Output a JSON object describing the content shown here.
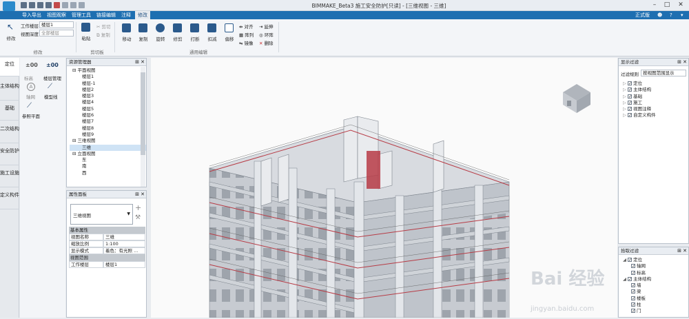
{
  "titlebar": {
    "title": "BIMMAKE_Beta3 施工安全防护[只读] - [三维视图 - 三维]",
    "window_buttons": [
      "–",
      "□",
      "✕"
    ]
  },
  "menubar": {
    "items": [
      "导入导出",
      "视图观察",
      "管理工具",
      "链接编辑",
      "注释",
      "修改"
    ],
    "active": "修改",
    "right_label": "正式版"
  },
  "ribbon": {
    "modify": {
      "label": "修改",
      "group": "修改"
    },
    "work_level_label": "工作楼层",
    "work_level_value": "楼层1",
    "view_depth_label": "视图深度",
    "view_depth_value": "全部楼层",
    "clipboard": {
      "paste": "粘贴",
      "cut": "剪切",
      "copy": "复制",
      "group": "剪切板"
    },
    "edit_tools": [
      "移动",
      "复制",
      "旋转",
      "修剪",
      "打断",
      "扣减",
      "偏移"
    ],
    "edit_small": [
      "对齐",
      "延伸",
      "阵列",
      "环阵",
      "镜像",
      "删除"
    ],
    "edit_group": "通用编辑"
  },
  "left_tabs": [
    "定位",
    "主体结构",
    "基础",
    "二次结构",
    "安全防护",
    "施工设施",
    "定义构件"
  ],
  "tool_panel": {
    "items": [
      {
        "name": "±00",
        "label": "标高"
      },
      {
        "name": "±00",
        "label": "楼层管理"
      },
      {
        "name": "A",
        "label": "轴网"
      },
      {
        "name": "",
        "label": "模型线"
      },
      {
        "name": "",
        "label": "参照平面"
      }
    ]
  },
  "resource_manager": {
    "title": "资源管理器",
    "tree": [
      {
        "label": "平面视图",
        "level": 0,
        "expanded": true
      },
      {
        "label": "楼层1",
        "level": 1
      },
      {
        "label": "楼层-1",
        "level": 1
      },
      {
        "label": "楼层2",
        "level": 1
      },
      {
        "label": "楼层3",
        "level": 1
      },
      {
        "label": "楼层4",
        "level": 1
      },
      {
        "label": "楼层5",
        "level": 1
      },
      {
        "label": "楼层6",
        "level": 1
      },
      {
        "label": "楼层7",
        "level": 1
      },
      {
        "label": "楼层8",
        "level": 1
      },
      {
        "label": "楼层9",
        "level": 1
      },
      {
        "label": "三维视图",
        "level": 0,
        "expanded": true
      },
      {
        "label": "三维",
        "level": 1,
        "selected": true
      },
      {
        "label": "立面视图",
        "level": 0,
        "expanded": true
      },
      {
        "label": "东",
        "level": 1
      },
      {
        "label": "南",
        "level": 1
      },
      {
        "label": "西",
        "level": 1
      }
    ]
  },
  "properties": {
    "title": "属性面板",
    "type_value": "三维视图",
    "basic_section": "基本属性",
    "rows": [
      {
        "k": "视图名称",
        "v": "三维"
      },
      {
        "k": "缩放比例",
        "v": "1:100"
      },
      {
        "k": "显示模式",
        "v": "着色：有光照 ..."
      }
    ],
    "range_section": "视图范围",
    "range_rows": [
      {
        "k": "工作楼层",
        "v": "楼层1"
      }
    ]
  },
  "display_filter": {
    "title": "显示过滤",
    "rule_label": "过滤规则",
    "rule_value": "按视图范围显示",
    "items": [
      "定位",
      "主体结构",
      "基础",
      "施工",
      "视图注释",
      "自定义构件"
    ]
  },
  "pick_filter": {
    "title": "拾取过滤",
    "items": [
      {
        "label": "定位",
        "level": 0
      },
      {
        "label": "轴网",
        "level": 1
      },
      {
        "label": "标高",
        "level": 1
      },
      {
        "label": "主体结构",
        "level": 0
      },
      {
        "label": "墙",
        "level": 1
      },
      {
        "label": "梁",
        "level": 1
      },
      {
        "label": "楼板",
        "level": 1
      },
      {
        "label": "柱",
        "level": 1
      },
      {
        "label": "门",
        "level": 1
      }
    ]
  },
  "watermark": {
    "text": "Bai 经验",
    "url": "jingyan.baidu.com"
  },
  "colors": {
    "menubar": "#1e6fb1",
    "accent_red": "#b73b45",
    "building": "#c7cbd1"
  }
}
